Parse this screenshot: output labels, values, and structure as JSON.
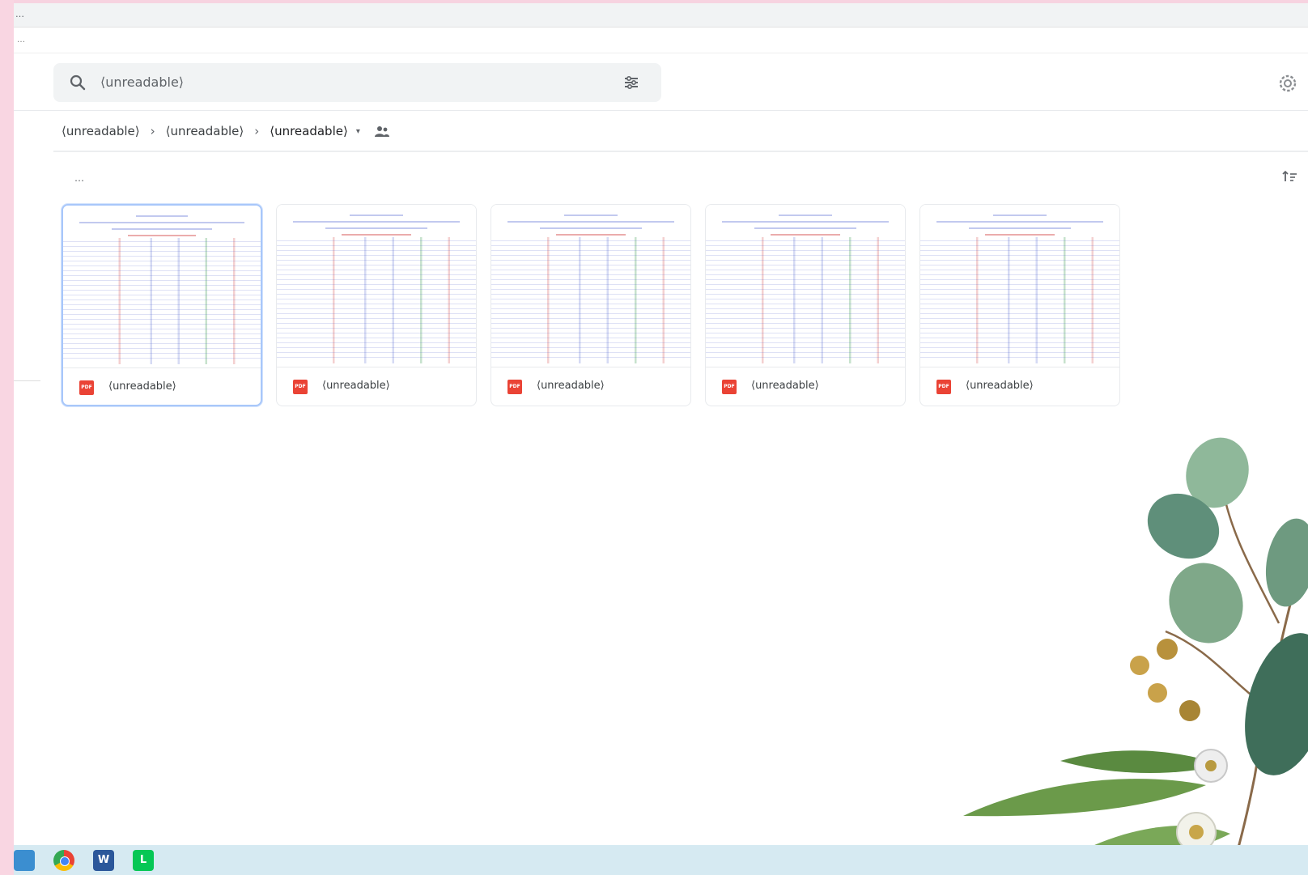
{
  "browser": {
    "url": "…"
  },
  "menu": {
    "glyph": "…"
  },
  "search": {
    "placeholder": "⟨unreadable⟩"
  },
  "breadcrumb": {
    "items": [
      "⟨unreadable⟩",
      "⟨unreadable⟩",
      "⟨unreadable⟩"
    ],
    "separator": "›",
    "caret": "▾"
  },
  "section": {
    "label": "…"
  },
  "files": [
    {
      "name": "⟨unreadable⟩",
      "type_label": "PDF",
      "selected": true
    },
    {
      "name": "⟨unreadable⟩",
      "type_label": "PDF",
      "selected": false
    },
    {
      "name": "⟨unreadable⟩",
      "type_label": "PDF",
      "selected": false
    },
    {
      "name": "⟨unreadable⟩",
      "type_label": "PDF",
      "selected": false
    },
    {
      "name": "⟨unreadable⟩",
      "type_label": "PDF",
      "selected": false
    }
  ],
  "taskbar": {
    "apps": [
      "file-explorer-icon",
      "chrome-icon",
      "word-icon",
      "line-icon"
    ],
    "word_glyph": "W",
    "line_glyph": "L"
  },
  "colors": {
    "pdf_red": "#ea4335",
    "selection_blue": "#a8c7fa",
    "border_pink": "#f9d6e2",
    "taskbar": "#d6eaf2"
  }
}
